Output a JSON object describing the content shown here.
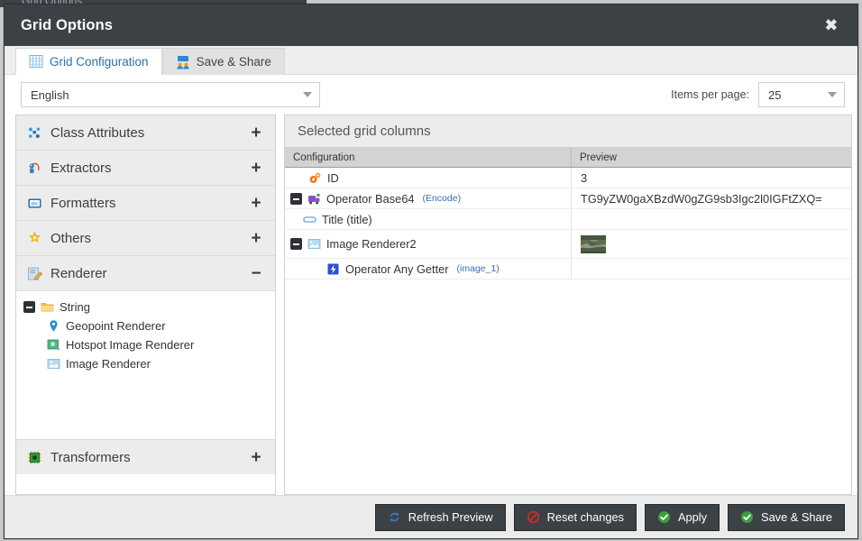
{
  "background": {
    "ghost_text": "Grid Options"
  },
  "dialog": {
    "title": "Grid Options",
    "close_label": "✖"
  },
  "tabs": [
    {
      "label": "Grid Configuration",
      "icon": "grid-icon",
      "active": true
    },
    {
      "label": "Save & Share",
      "icon": "share-icon",
      "active": false
    }
  ],
  "toolbar": {
    "language_value": "English",
    "items_per_page_label": "Items per page:",
    "items_per_page_value": "25"
  },
  "sidebar": {
    "sections": [
      {
        "label": "Class Attributes",
        "icon": "class-attributes-icon",
        "toggle": "+",
        "expanded": false
      },
      {
        "label": "Extractors",
        "icon": "extractors-icon",
        "toggle": "+",
        "expanded": false
      },
      {
        "label": "Formatters",
        "icon": "formatters-icon",
        "toggle": "+",
        "expanded": false
      },
      {
        "label": "Others",
        "icon": "others-icon",
        "toggle": "+",
        "expanded": false
      },
      {
        "label": "Renderer",
        "icon": "renderer-icon",
        "toggle": "−",
        "expanded": true
      },
      {
        "label": "Transformers",
        "icon": "transformers-icon",
        "toggle": "+",
        "expanded": false
      }
    ],
    "renderer_tree": {
      "group_label": "String",
      "group_icon": "folder-icon",
      "items": [
        {
          "label": "Geopoint Renderer",
          "icon": "geopoint-icon"
        },
        {
          "label": "Hotspot Image Renderer",
          "icon": "hotspot-image-icon"
        },
        {
          "label": "Image Renderer",
          "icon": "image-icon"
        }
      ]
    }
  },
  "main": {
    "heading": "Selected grid columns",
    "columns": [
      "Configuration",
      "Preview"
    ],
    "rows": [
      {
        "label": "ID",
        "suffix": "",
        "icon": "gears-icon",
        "indent": 1,
        "expander": false,
        "preview_text": "3",
        "preview_image": false
      },
      {
        "label": "Operator Base64",
        "suffix": "(Encode)",
        "icon": "operator-icon",
        "indent": 0,
        "expander": true,
        "preview_text": "TG9yZW0gaXBzdW0gZG9sb3Igc2l0IGFtZXQ=",
        "preview_image": false
      },
      {
        "label": "Title (title)",
        "suffix": "",
        "icon": "field-icon",
        "indent": 2,
        "expander": false,
        "preview_text": "",
        "preview_image": false
      },
      {
        "label": "Image Renderer2",
        "suffix": "",
        "icon": "image-icon",
        "indent": 0,
        "expander": true,
        "preview_text": "",
        "preview_image": true
      },
      {
        "label": "Operator Any Getter",
        "suffix": "(image_1)",
        "icon": "getter-icon",
        "indent": 2,
        "expander": false,
        "preview_text": "",
        "preview_image": false
      }
    ]
  },
  "footer": {
    "buttons": [
      {
        "label": "Refresh Preview",
        "icon": "refresh-icon"
      },
      {
        "label": "Reset changes",
        "icon": "reset-icon"
      },
      {
        "label": "Apply",
        "icon": "check-icon"
      },
      {
        "label": "Save & Share",
        "icon": "check-icon"
      }
    ]
  },
  "colors": {
    "titlebar": "#3c4146",
    "accent_link": "#2c6fb5",
    "paren_blue": "#3b6fbf",
    "accordion_header": "#ececec",
    "grid_header": "#d3d3d3",
    "footer": "#ebebeb",
    "button": "#3c4146",
    "ok_green": "#3aa03a",
    "reset_red": "#cf2b2b"
  }
}
